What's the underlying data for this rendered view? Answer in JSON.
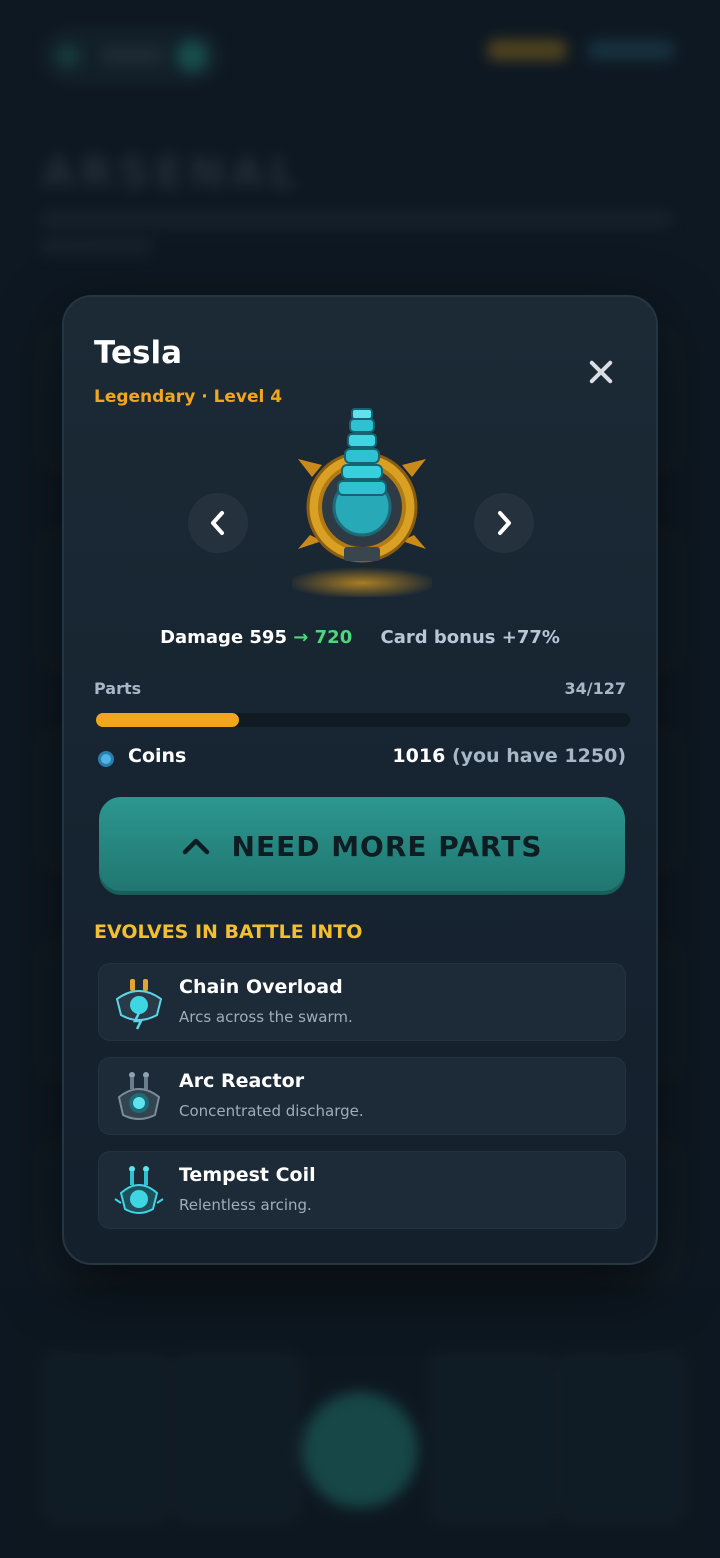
{
  "background": {
    "title": "ARSENAL"
  },
  "modal": {
    "title": "Tesla",
    "subtitle": "Legendary · Level 4",
    "close_icon": "close-icon",
    "prev_icon": "chevron-left-icon",
    "next_icon": "chevron-right-icon",
    "stats": {
      "damage_label": "Damage 595",
      "arrow": "→",
      "damage_new": "720",
      "card_bonus": "Card bonus +77%"
    },
    "parts": {
      "label": "Parts",
      "count": "34/127",
      "progress": 0.268
    },
    "coins": {
      "label": "Coins",
      "cost": "1016",
      "have": "(you have 1250)"
    },
    "cta": {
      "icon": "chevron-up-icon",
      "label": "NEED MORE PARTS"
    },
    "evolve_heading": "EVOLVES IN BATTLE INTO",
    "evolutions": [
      {
        "name": "Chain Overload",
        "desc": "Arcs across the swarm."
      },
      {
        "name": "Arc Reactor",
        "desc": "Concentrated discharge."
      },
      {
        "name": "Tempest Coil",
        "desc": "Relentless arcing."
      }
    ]
  },
  "colors": {
    "accent_orange": "#f2a61e",
    "accent_gold": "#f2bf30",
    "teal_button": "#2c9790",
    "upgrade_green": "#4fd67a"
  }
}
